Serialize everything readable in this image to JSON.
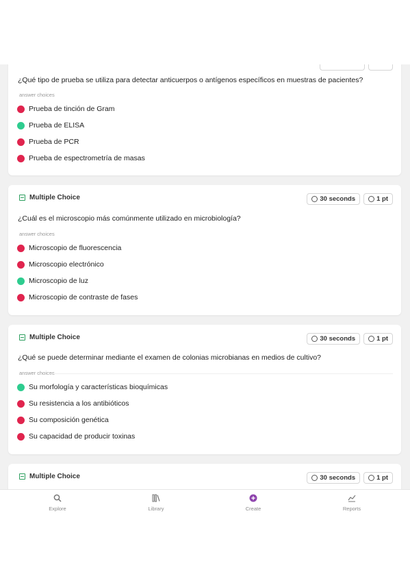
{
  "labels": {
    "answer_choices": "answer choices"
  },
  "top_question": {
    "text": "¿Qué tipo de prueba se utiliza para detectar anticuerpos o antígenos específicos en muestras de pacientes?",
    "choices": [
      {
        "text": "Prueba de tinción de Gram",
        "status": "incorrect"
      },
      {
        "text": "Prueba de ELISA",
        "status": "correct"
      },
      {
        "text": "Prueba de PCR",
        "status": "incorrect"
      },
      {
        "text": "Prueba de espectrometría de masas",
        "status": "incorrect"
      }
    ]
  },
  "questions": [
    {
      "type": "Multiple Choice",
      "time": "30 seconds",
      "points": "1 pt",
      "text": "¿Cuál es el microscopio más comúnmente utilizado en microbiología?",
      "choices": [
        {
          "text": "Microscopio de fluorescencia",
          "status": "incorrect"
        },
        {
          "text": "Microscopio electrónico",
          "status": "incorrect"
        },
        {
          "text": "Microscopio de luz",
          "status": "correct"
        },
        {
          "text": "Microscopio de contraste de fases",
          "status": "incorrect"
        }
      ]
    },
    {
      "type": "Multiple Choice",
      "time": "30 seconds",
      "points": "1 pt",
      "text": "¿Qué se puede determinar mediante el examen de colonias microbianas en medios de cultivo?",
      "choices": [
        {
          "text": "Su morfología y características bioquímicas",
          "status": "correct"
        },
        {
          "text": "Su resistencia a los antibióticos",
          "status": "incorrect"
        },
        {
          "text": "Su composición genética",
          "status": "incorrect"
        },
        {
          "text": "Su capacidad de producir toxinas",
          "status": "incorrect"
        }
      ]
    },
    {
      "type": "Multiple Choice",
      "time": "30 seconds",
      "points": "1 pt"
    }
  ],
  "colors": {
    "correct": "#2ecc8f",
    "incorrect": "#e0244e",
    "accent": "#8e44ad"
  },
  "nav": [
    {
      "label": "Explore",
      "icon": "search-icon"
    },
    {
      "label": "Library",
      "icon": "library-icon"
    },
    {
      "label": "Create",
      "icon": "plus-circle-icon",
      "active": true
    },
    {
      "label": "Reports",
      "icon": "chart-icon"
    }
  ]
}
